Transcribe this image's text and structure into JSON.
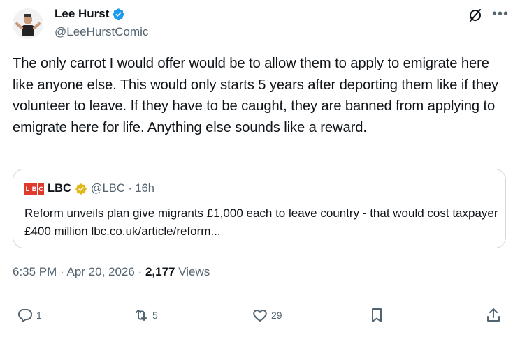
{
  "author": {
    "name": "Lee Hurst",
    "handle": "@LeeHurstComic"
  },
  "tweet": {
    "text": "The only carrot I would offer would be to allow them to apply to emigrate here like anyone else. This would only starts 5 years after deporting them like if they volunteer to leave. If they have to be caught, they are banned from applying to emigrate here for life. Anything else sounds like a reward."
  },
  "quote": {
    "logo_letters": [
      "L",
      "B",
      "C"
    ],
    "name": "LBC",
    "handle_time": "@LBC · 16h",
    "text": "Reform unveils plan give migrants £1,000 each to leave country - that would cost taxpayer £400 million lbc.co.uk/article/reform..."
  },
  "meta": {
    "time_date": "6:35 PM · Apr 20, 2026 · ",
    "views_count": "2,177",
    "views_label": " Views"
  },
  "actions": {
    "replies": "1",
    "reposts": "5",
    "likes": "29"
  },
  "colors": {
    "verified_blue": "#1d9bf0",
    "verified_gold": "#e2b719",
    "lbc_red": "#e03a2f",
    "muted": "#536471"
  },
  "icons": [
    "verified-badge-icon",
    "grok-icon",
    "more-icon",
    "reply-icon",
    "repost-icon",
    "like-icon",
    "bookmark-icon",
    "share-icon"
  ]
}
